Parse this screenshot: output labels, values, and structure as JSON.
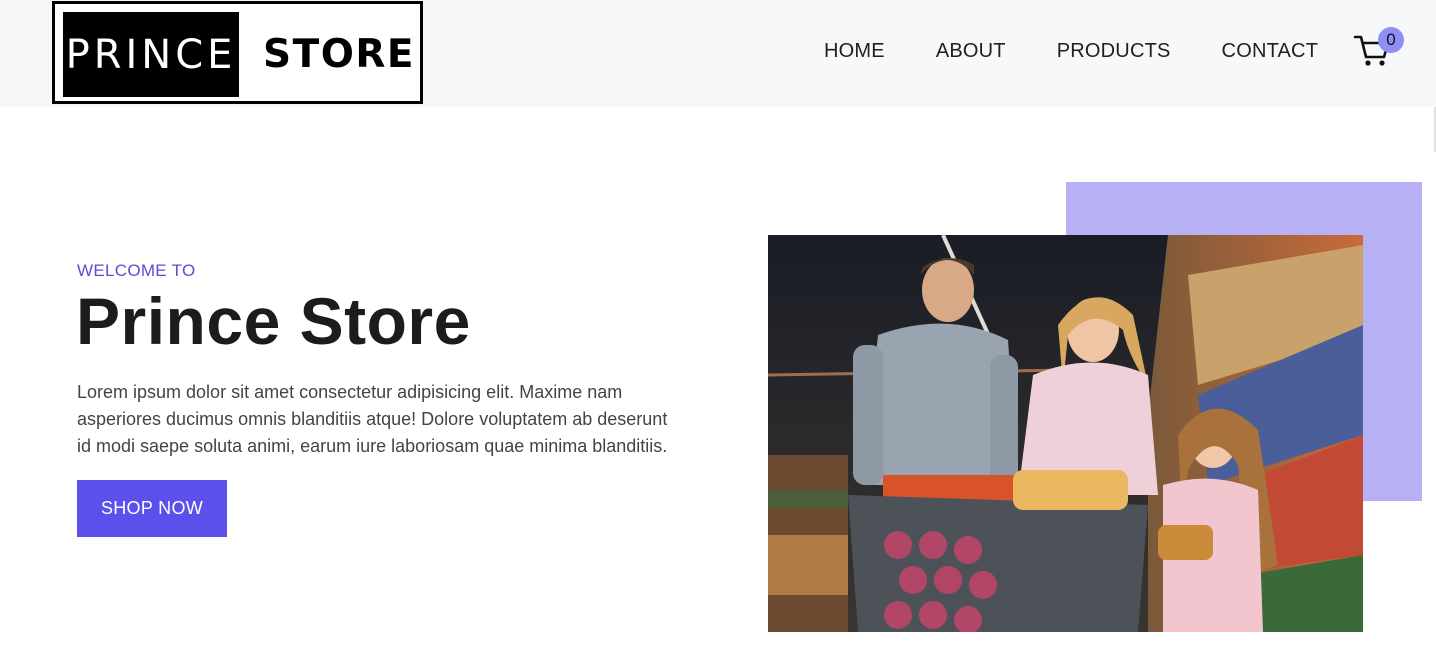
{
  "header": {
    "logo_left": "PRINCE",
    "logo_right": "STORE",
    "nav": [
      "HOME",
      "ABOUT",
      "PRODUCTS",
      "CONTACT"
    ],
    "cart_icon": "cart-icon",
    "cart_count": "0"
  },
  "hero": {
    "eyebrow": "WELCOME TO",
    "title": "Prince Store",
    "description": "Lorem ipsum dolor sit amet consectetur adipisicing elit. Maxime nam asperiores ducimus omnis blanditiis atque! Dolore voluptatem ab deserunt id modi saepe soluta animi, earum iure laboriosam quae minima blanditiis.",
    "cta": "SHOP NOW",
    "image": "family-shopping-in-supermarket-photo"
  },
  "colors": {
    "accent": "#5b50ec",
    "accent_light": "#b8b0f4",
    "eyebrow": "#5b4cd6",
    "badge": "#8f8ff5"
  }
}
